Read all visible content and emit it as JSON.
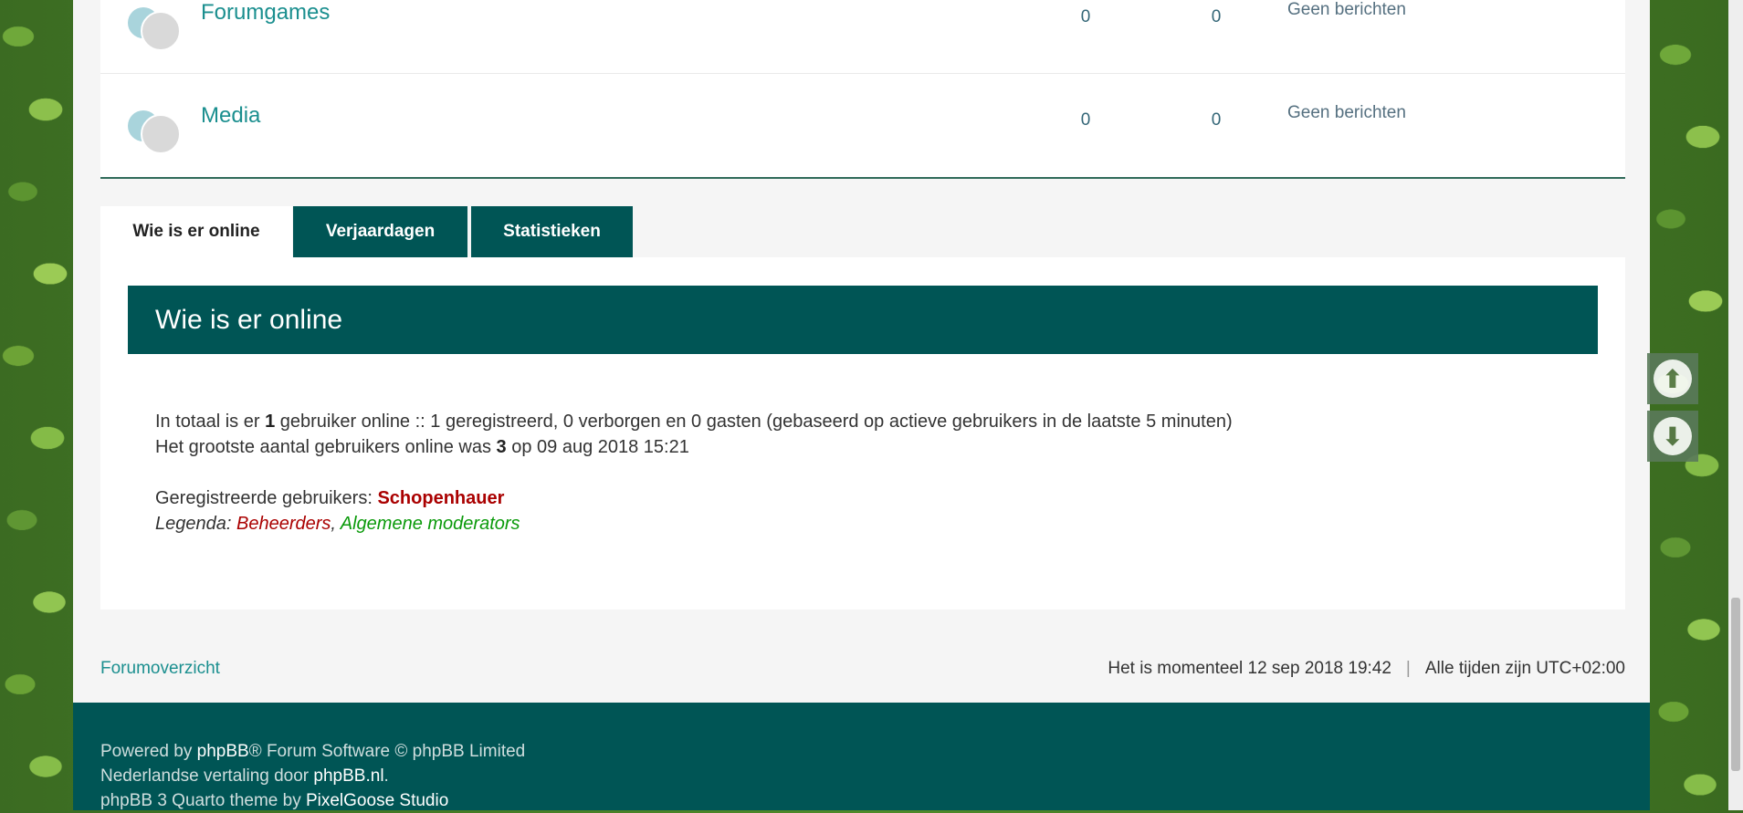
{
  "forums": [
    {
      "title": "Forumgames",
      "topics": "0",
      "posts": "0",
      "lastpost": "Geen berichten"
    },
    {
      "title": "Media",
      "topics": "0",
      "posts": "0",
      "lastpost": "Geen berichten"
    }
  ],
  "tabs": {
    "online": "Wie is er online",
    "birthdays": "Verjaardagen",
    "stats": "Statistieken"
  },
  "online": {
    "heading": "Wie is er online",
    "line1_pre": "In totaal is er ",
    "line1_count": "1",
    "line1_post": " gebruiker online :: 1 geregistreerd, 0 verborgen en 0 gasten (gebaseerd op actieve gebruikers in de laatste 5 minuten)",
    "line2_pre": "Het grootste aantal gebruikers online was ",
    "line2_count": "3",
    "line2_post": " op 09 aug 2018 15:21",
    "registered_label": "Geregistreerde gebruikers: ",
    "registered_user": "Schopenhauer",
    "legend_label": "Legenda: ",
    "legend_admins": "Beheerders",
    "legend_sep": ", ",
    "legend_mods": "Algemene moderators"
  },
  "footer": {
    "nav": "Forumoverzicht",
    "time": "Het is momenteel 12 sep 2018 19:42",
    "sep": "|",
    "timezone": "Alle tijden zijn UTC+02:00"
  },
  "credits": {
    "powered_pre": "Powered by ",
    "powered_link": "phpBB",
    "powered_post": "® Forum Software © phpBB Limited",
    "trans_pre": "Nederlandse vertaling door ",
    "trans_link": "phpBB.nl",
    "trans_post": ".",
    "theme_pre": "phpBB 3 Quarto theme by ",
    "theme_link": "PixelGoose Studio"
  },
  "scroll": {
    "up_icon": "arrow-up-circle",
    "down_icon": "arrow-down-circle",
    "up_glyph": "⬆",
    "down_glyph": "⬇"
  },
  "colors": {
    "accent": "#005555",
    "link": "#1b8f8f",
    "admin": "#aa0000",
    "moderator": "#0a9a0a"
  }
}
